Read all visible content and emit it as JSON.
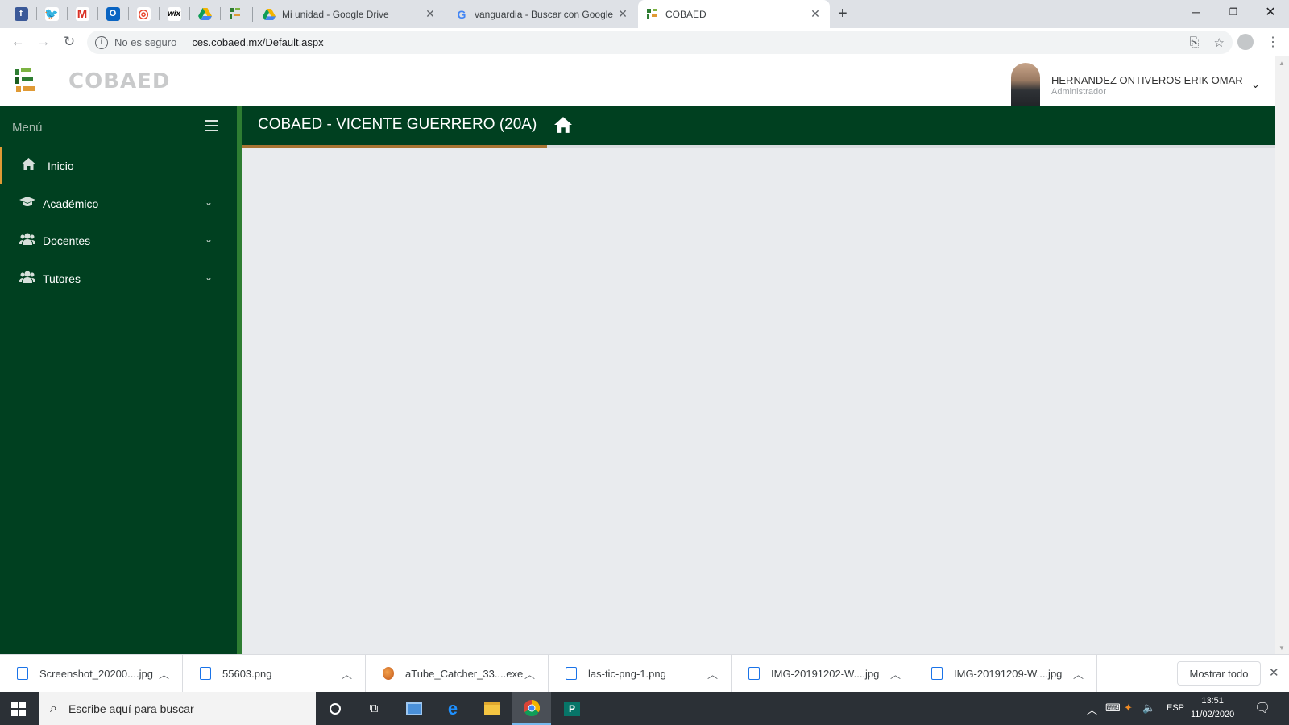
{
  "browser": {
    "pinned_tabs": [
      {
        "icon": "facebook-icon",
        "glyph": "f",
        "color": "#3b5998"
      },
      {
        "icon": "twitter-icon",
        "glyph": "t",
        "color": "#1da1f2"
      },
      {
        "icon": "gmail-icon",
        "glyph": "M",
        "color": "#d93025"
      },
      {
        "icon": "outlook-icon",
        "glyph": "O",
        "color": "#0a64c2"
      },
      {
        "icon": "target-icon",
        "glyph": "◎",
        "color": "#e8452c"
      },
      {
        "icon": "wix-icon",
        "glyph": "wix",
        "color": "#000000"
      },
      {
        "icon": "google-drive-icon",
        "glyph": "▲",
        "color": "#f4b400"
      },
      {
        "icon": "cobaed-favicon-icon",
        "glyph": "c",
        "color": "#2e7d32"
      }
    ],
    "tabs": [
      {
        "title": "Mi unidad - Google Drive",
        "icon": "google-drive-icon"
      },
      {
        "title": "vanguardia - Buscar con Google",
        "icon": "google-icon"
      },
      {
        "title": "COBAED",
        "icon": "cobaed-favicon-icon",
        "active": true
      }
    ],
    "security_label": "No es seguro",
    "url": "ces.cobaed.mx/Default.aspx"
  },
  "site": {
    "logo_text": "COBAED",
    "user": {
      "name": "HERNANDEZ ONTIVEROS ERIK OMAR",
      "role": "Administrador"
    },
    "menu_title": "Menú",
    "nav": [
      {
        "label": "Inicio",
        "icon": "home-icon",
        "active": true
      },
      {
        "label": "Académico",
        "icon": "graduation-cap-icon",
        "has_submenu": true
      },
      {
        "label": "Docentes",
        "icon": "users-icon",
        "has_submenu": true
      },
      {
        "label": "Tutores",
        "icon": "users-icon",
        "has_submenu": true
      }
    ],
    "page_title": "COBAED - VICENTE GUERRERO (20A)",
    "colors": {
      "primary_green": "#004020",
      "accent_orange": "#a87433"
    }
  },
  "downloads": {
    "items": [
      {
        "name": "Screenshot_20200....jpg",
        "type": "image"
      },
      {
        "name": "55603.png",
        "type": "image"
      },
      {
        "name": "aTube_Catcher_33....exe",
        "type": "exe"
      },
      {
        "name": "las-tic-png-1.png",
        "type": "image"
      },
      {
        "name": "IMG-20191202-W....jpg",
        "type": "image"
      },
      {
        "name": "IMG-20191209-W....jpg",
        "type": "image"
      }
    ],
    "show_all_label": "Mostrar todo"
  },
  "taskbar": {
    "search_placeholder": "Escribe aquí para buscar",
    "language": "ESP",
    "time": "13:51",
    "date": "11/02/2020"
  }
}
